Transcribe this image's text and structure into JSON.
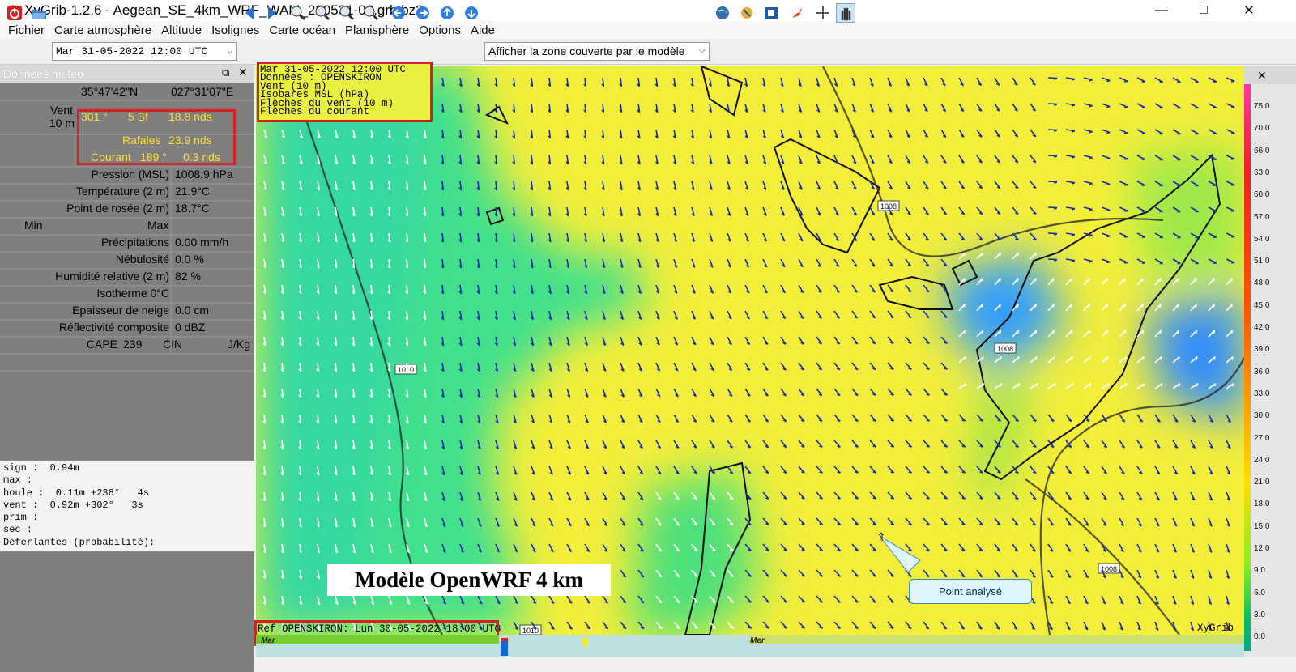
{
  "window": {
    "title": "XyGrib-1.2.6 - Aegean_SE_4km_WRF_WAM_220531-00.grb.bz2",
    "minimize": "—",
    "maximize": "□",
    "close": "✕"
  },
  "menu": [
    "Fichier",
    "Carte atmosphère",
    "Altitude",
    "Isolignes",
    "Carte océan",
    "Planisphère",
    "Options",
    "Aide"
  ],
  "toolbar": {
    "date": "Mar 31-05-2022 12:00 UTC",
    "zone": "Afficher la zone couverte par le modèle"
  },
  "panel": {
    "title": "Données météo",
    "lat": "35°47'42\"N",
    "lon": "027°31'07\"E",
    "wind_label": "Vent",
    "wind_level": "10 m",
    "wind_dir": "301 °",
    "wind_bf": "5 Bf",
    "wind_speed": "18.8  nds",
    "gust_label": "Rafales",
    "gust_value": "23.9  nds",
    "current_label": "Courant",
    "current_dir": "189 °",
    "current_speed": "0.3  nds",
    "rows": [
      {
        "label": "Pression (MSL)",
        "value": "1008.9 hPa"
      },
      {
        "label": "Température (2 m)",
        "value": "21.9°C"
      },
      {
        "label": "Point de rosée (2 m)",
        "value": "18.7°C"
      }
    ],
    "min_label": "Min",
    "max_label": "Max",
    "rows2": [
      {
        "label": "Précipitations",
        "value": "0.00 mm/h"
      },
      {
        "label": "Nébulosité",
        "value": "0.0 %"
      },
      {
        "label": "Humidité relative (2 m)",
        "value": "82 %"
      },
      {
        "label": "Isotherme 0°C",
        "value": ""
      },
      {
        "label": "Epaisseur de neige",
        "value": "0.0 cm"
      },
      {
        "label": "Réflectivité composite",
        "value": "0 dBZ"
      }
    ],
    "cape_label": "CAPE",
    "cape_value": "239",
    "cin_label": "CIN",
    "cin_unit": "J/Kg",
    "waves": "sign :  0.94m\nmax :\nhoule :  0.11m +238°   4s\nvent :  0.92m +302°   3s\nprim :\nsec :\nDéferlantes (probabilité):"
  },
  "map": {
    "info": "Mar 31-05-2022 12:00 UTC\nDonnées : OPENSKIRON\nVent (10 m)\nIsobares MSL (hPa)\nFlèches du vent (10 m)\nFlèches du courant",
    "model_label": "Modèle OpenWRF 4 km",
    "point_label": "Point analysé",
    "ref": "Ref OPENSKIRON: Lun 30-05-2022 18:00 UTC",
    "brand": "XyGrib",
    "isobars": [
      "1008",
      "1008",
      "1010",
      "1008",
      "1010"
    ],
    "timeline_days": [
      "Mar",
      "Mer"
    ],
    "legend": [
      "75.0",
      "70.0",
      "66.0",
      "63.0",
      "60.0",
      "57.0",
      "54.0",
      "51.0",
      "48.0",
      "45.0",
      "42.0",
      "39.0",
      "36.0",
      "33.0",
      "30.0",
      "27.0",
      "24.0",
      "21.0",
      "18.0",
      "15.0",
      "12.0",
      "9.0",
      "6.0",
      "3.0",
      "0.0"
    ]
  },
  "colors": {
    "accent_red": "#d42020",
    "map_yellow": "#f6f038",
    "map_green": "#3ee07a",
    "map_blue": "#1f7bff"
  }
}
